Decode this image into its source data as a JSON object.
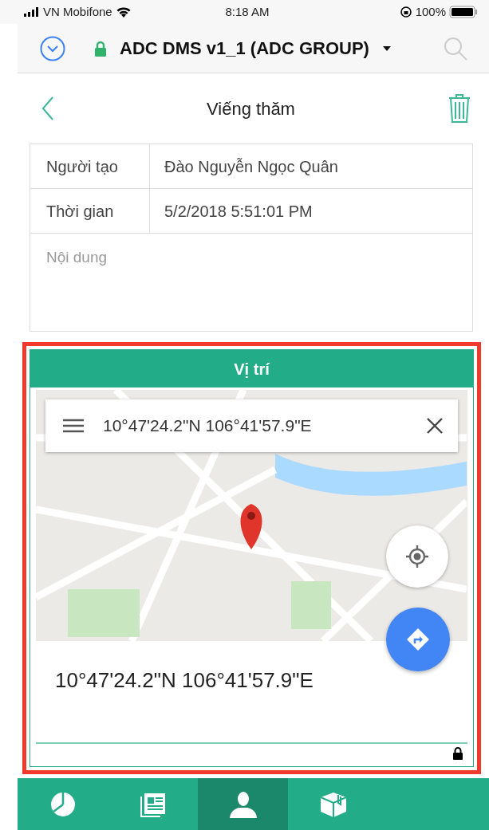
{
  "status_bar": {
    "carrier": "VN Mobifone",
    "time": "8:18 AM",
    "battery": "100%"
  },
  "browser": {
    "title": "ADC DMS v1_1 (ADC GROUP)"
  },
  "header": {
    "title": "Viếng thăm"
  },
  "fields": [
    {
      "label": "Người tạo",
      "value": "Đào Nguyễn Ngọc Quân"
    },
    {
      "label": "Thời gian",
      "value": "5/2/2018 5:51:01 PM"
    }
  ],
  "content": {
    "placeholder": "Nội dung"
  },
  "location": {
    "title": "Vị trí",
    "search_text": "10°47'24.2\"N 106°41'57.9\"E",
    "coordinates": "10°47'24.2\"N 106°41'57.9\"E"
  },
  "bottom_nav": [
    {
      "kind": "chart",
      "selected": false
    },
    {
      "kind": "news",
      "selected": false
    },
    {
      "kind": "person",
      "selected": true
    },
    {
      "kind": "box",
      "selected": false
    }
  ]
}
